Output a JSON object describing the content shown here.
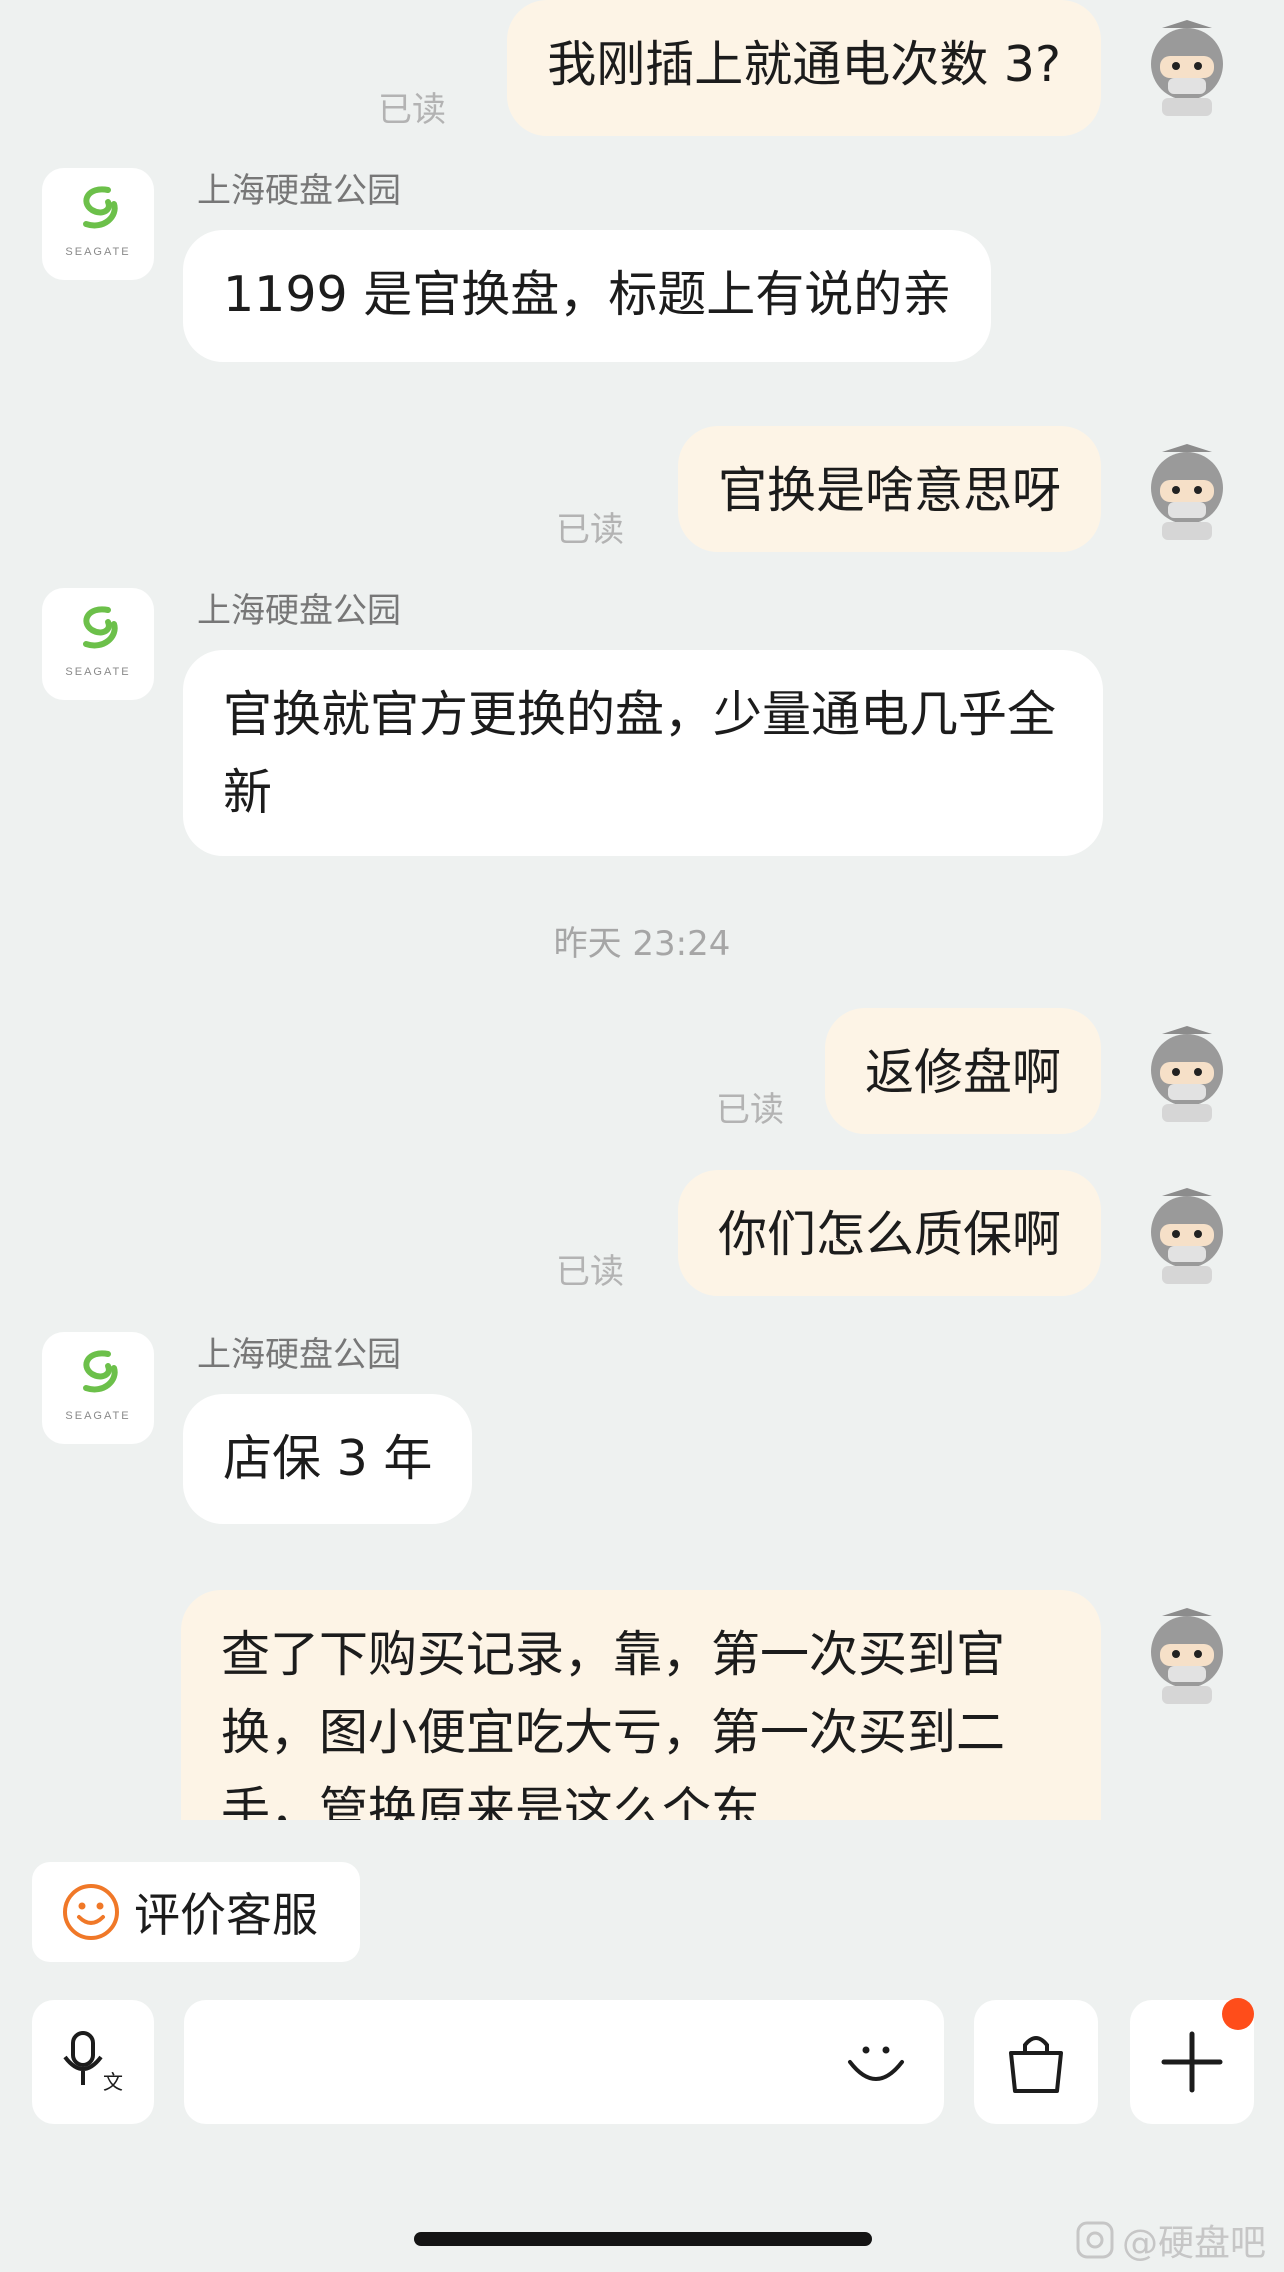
{
  "read_label": "已读",
  "shop_name": "上海硬盘公园",
  "shop_logo_text": "SEAGATE",
  "messages": [
    {
      "text": "我刚插上就通电次数 3?"
    },
    {
      "text": "1199 是官换盘，标题上有说的亲"
    },
    {
      "text": "官换是啥意思呀"
    },
    {
      "text": "官换就官方更换的盘，少量通电几乎全新"
    },
    {
      "text": "返修盘啊"
    },
    {
      "text": "你们怎么质保啊"
    },
    {
      "text": "店保 3 年"
    },
    {
      "text": "查了下购买记录，靠，第一次买到官换，图小便宜吃大亏，第一次买到二手，管换原来是这么个东"
    }
  ],
  "timestamp": "昨天 23:24",
  "rate_button": {
    "label": "评价客服"
  },
  "input_bar": {
    "voice_icon": "voice-input-icon",
    "emoji_icon": "smiley-icon",
    "bag_icon": "shopping-bag-icon",
    "plus_icon": "plus-icon"
  },
  "watermark": "@硬盘吧",
  "colors": {
    "background": "#eef1f0",
    "my_bubble": "#fdf4e6",
    "their_bubble": "#ffffff",
    "badge": "#ff4d1a",
    "rate_icon": "#f07828",
    "seagate_green": "#6cc04a"
  }
}
